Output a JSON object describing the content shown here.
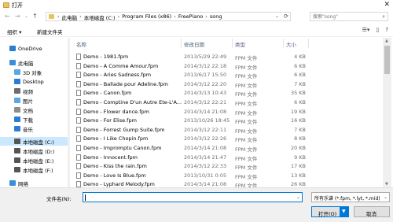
{
  "window": {
    "title": "打开",
    "close_glyph": "✕"
  },
  "nav": {
    "back": "←",
    "forward": "→",
    "dropdown": "⌄",
    "up": "↑"
  },
  "address": {
    "crumbs": [
      "此电脑",
      "本地磁盘 (C:)",
      "Program Files (x86)",
      "FreePiano",
      "song"
    ],
    "separator": "›",
    "dropdown": "⌄",
    "refresh": "⟳"
  },
  "search": {
    "placeholder": "搜索\"song\"",
    "icon": "search-icon"
  },
  "toolbar": {
    "organize": "组织 ▾",
    "new_folder": "新建文件夹"
  },
  "sidebar": {
    "items": [
      {
        "label": "OneDrive",
        "icon": "cloud-icon",
        "color": "#2b7cd3"
      },
      {
        "label": "此电脑",
        "icon": "computer-icon",
        "color": "#3a8fd8"
      },
      {
        "label": "3D 对象",
        "icon": "cube-icon",
        "color": "#5aa7e6"
      },
      {
        "label": "Desktop",
        "icon": "desktop-icon",
        "color": "#2b7cd3"
      },
      {
        "label": "视频",
        "icon": "video-icon",
        "color": "#6d6d6d"
      },
      {
        "label": "图片",
        "icon": "picture-icon",
        "color": "#5aa7e6"
      },
      {
        "label": "文档",
        "icon": "document-icon",
        "color": "#8d8d8d"
      },
      {
        "label": "下载",
        "icon": "download-icon",
        "color": "#2b7cd3"
      },
      {
        "label": "音乐",
        "icon": "music-icon",
        "color": "#2b7cd3"
      },
      {
        "label": "本地磁盘 (C:)",
        "icon": "drive-icon",
        "color": "#555555",
        "selected": true
      },
      {
        "label": "本地磁盘 (D:)",
        "icon": "drive-icon",
        "color": "#555555"
      },
      {
        "label": "本地磁盘 (E:)",
        "icon": "drive-icon",
        "color": "#555555"
      },
      {
        "label": "本地磁盘 (F:)",
        "icon": "drive-icon",
        "color": "#555555"
      },
      {
        "label": "网络",
        "icon": "network-icon",
        "color": "#3a8fd8"
      }
    ]
  },
  "columns": {
    "name": "名称",
    "date": "修改日期",
    "type": "类型",
    "size": "大小"
  },
  "files": [
    {
      "name": "Demo - 1981.fpm",
      "date": "2013/5/29 22:49",
      "type": "FPM 文件",
      "size": "4 KB"
    },
    {
      "name": "Demo - A Comme Amour.fpm",
      "date": "2014/3/12 22:18",
      "type": "FPM 文件",
      "size": "6 KB"
    },
    {
      "name": "Demo - Aries Sadness.fpm",
      "date": "2013/6/17 15:50",
      "type": "FPM 文件",
      "size": "6 KB"
    },
    {
      "name": "Demo - Ballade pour Adeline.fpm",
      "date": "2014/3/12 22:20",
      "type": "FPM 文件",
      "size": "7 KB"
    },
    {
      "name": "Demo - Canon.fpm",
      "date": "2014/3/13 10:43",
      "type": "FPM 文件",
      "size": "35 KB"
    },
    {
      "name": "Demo - Comptine D'un Autre Ete-L'A...",
      "date": "2014/3/12 22:21",
      "type": "FPM 文件",
      "size": "6 KB"
    },
    {
      "name": "Demo - Flower dance.fpm",
      "date": "2014/3/14 21:08",
      "type": "FPM 文件",
      "size": "19 KB"
    },
    {
      "name": "Demo - For Elise.fpm",
      "date": "2013/10/26 18:45",
      "type": "FPM 文件",
      "size": "16 KB"
    },
    {
      "name": "Demo - Forrest Gump Suite.fpm",
      "date": "2014/3/12 22:11",
      "type": "FPM 文件",
      "size": "7 KB"
    },
    {
      "name": "Demo - I Like Chopin.fpm",
      "date": "2014/3/12 22:26",
      "type": "FPM 文件",
      "size": "8 KB"
    },
    {
      "name": "Demo - Impromptu  Canon.fpm",
      "date": "2014/3/14 21:08",
      "type": "FPM 文件",
      "size": "20 KB"
    },
    {
      "name": "Demo - Innocent.fpm",
      "date": "2014/3/14 21:47",
      "type": "FPM 文件",
      "size": "9 KB"
    },
    {
      "name": "Demo - Kiss the rain.fpm",
      "date": "2014/3/12 22:33",
      "type": "FPM 文件",
      "size": "17 KB"
    },
    {
      "name": "Demo - Love Is Blue.fpm",
      "date": "2013/10/31 0:05",
      "type": "FPM 文件",
      "size": "13 KB"
    },
    {
      "name": "Demo - Lyphard Melody.fpm",
      "date": "2014/3/14 21:08",
      "type": "FPM 文件",
      "size": "26 KB"
    }
  ],
  "bottom": {
    "filename_label": "文件名(N):",
    "filename_value": "",
    "filter": "所有乐谱 (*.fpm, *.lyt, *.mid)",
    "open_label": "打开(O)",
    "cancel_label": "取消"
  }
}
